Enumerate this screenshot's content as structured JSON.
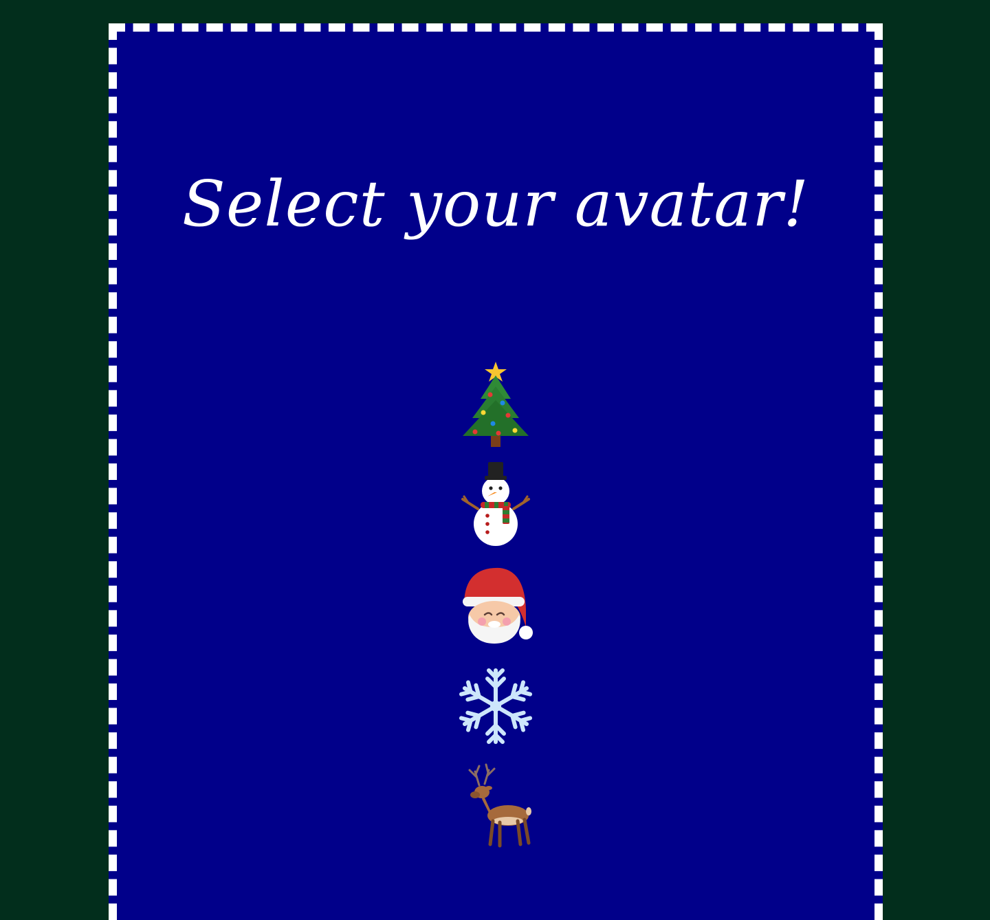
{
  "colors": {
    "page_background": "#022e1c",
    "panel_background": "#01008a",
    "panel_border": "#ffffff",
    "title_text": "#ffffff"
  },
  "title": "Select your avatar!",
  "avatars": [
    {
      "id": "christmas-tree",
      "icon": "christmas-tree-icon"
    },
    {
      "id": "snowman",
      "icon": "snowman-icon"
    },
    {
      "id": "santa",
      "icon": "santa-icon"
    },
    {
      "id": "snowflake",
      "icon": "snowflake-icon"
    },
    {
      "id": "deer",
      "icon": "deer-icon"
    }
  ]
}
